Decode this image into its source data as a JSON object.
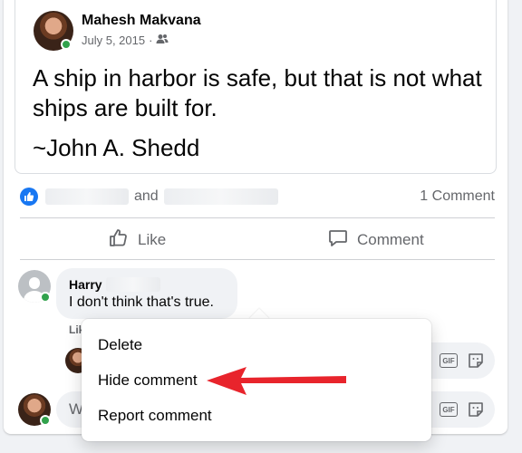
{
  "post": {
    "author": "Mahesh Makvana",
    "date": "July 5, 2015",
    "separator": "·",
    "text": "A ship in harbor is safe, but that is not what ships are built for.",
    "quote_author": "~John A. Shedd"
  },
  "reactions": {
    "and_text": "and",
    "comment_count": "1 Comment"
  },
  "actions": {
    "like_label": "Like",
    "comment_label": "Comment"
  },
  "comment": {
    "author": "Harry",
    "text": "I don't think that's true.",
    "like_label": "Lik"
  },
  "reply": {
    "placeholder": "W"
  },
  "menu": {
    "items": [
      "Delete",
      "Hide comment",
      "Report comment"
    ]
  },
  "colors": {
    "accent": "#1877f2",
    "online": "#31a24c",
    "annotation_arrow": "#e8242c"
  }
}
